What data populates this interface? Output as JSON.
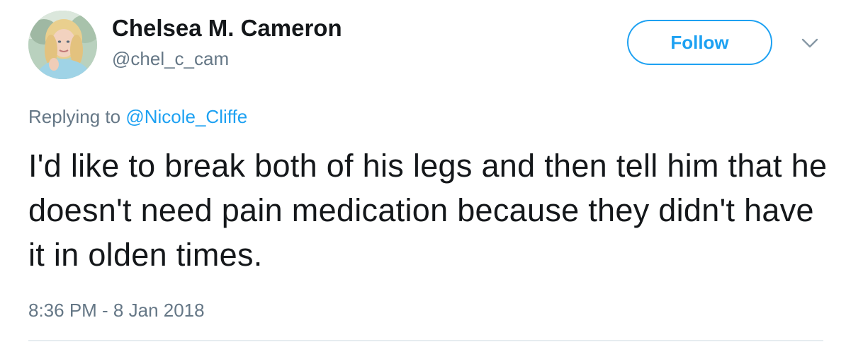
{
  "user": {
    "display_name": "Chelsea M. Cameron",
    "handle": "@chel_c_cam",
    "avatar_icon": "profile-photo"
  },
  "actions": {
    "follow_label": "Follow",
    "more_icon": "chevron-down-icon"
  },
  "reply": {
    "prefix": "Replying to ",
    "to_handle": "@Nicole_Cliffe"
  },
  "tweet": {
    "text": "I'd like to break both of his legs and then tell him that he doesn't need pain medication because they didn't have it in olden times.",
    "timestamp": "8:36 PM - 8 Jan 2018"
  },
  "colors": {
    "accent": "#1da1f2",
    "secondary_text": "#657786",
    "primary_text": "#14171a",
    "divider": "#e6ecf0"
  }
}
